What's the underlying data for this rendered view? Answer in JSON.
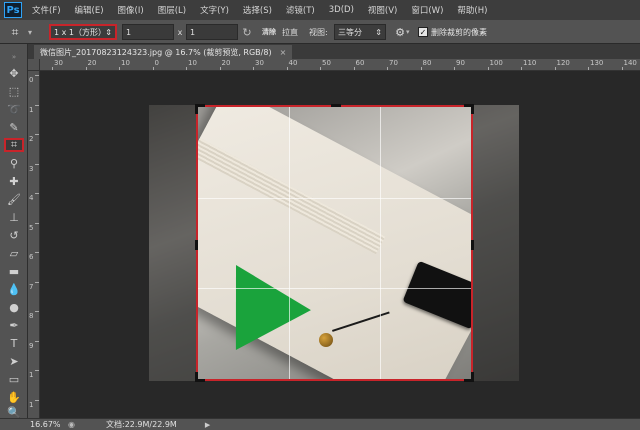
{
  "app": {
    "logo": "Ps"
  },
  "menu": [
    "文件(F)",
    "编辑(E)",
    "图像(I)",
    "图层(L)",
    "文字(Y)",
    "选择(S)",
    "滤镜(T)",
    "3D(D)",
    "视图(V)",
    "窗口(W)",
    "帮助(H)"
  ],
  "options": {
    "ratio_preset": "1 x 1（方形）",
    "width_value": "1",
    "x_separator": "x",
    "height_value": "1",
    "clear_label": "清除",
    "straighten_label": "拉直",
    "view_label": "视图:",
    "view_value": "三等分",
    "delete_pixels_label": "删除裁剪的像素",
    "delete_pixels_checked": true
  },
  "tab": {
    "title": "微信图片_20170823124323.jpg @ 16.7% (裁剪预览, RGB/8)",
    "close": "×"
  },
  "ruler_h": [
    "30",
    "20",
    "10",
    "0",
    "10",
    "20",
    "30",
    "40",
    "50",
    "60",
    "70",
    "80",
    "90",
    "100",
    "110",
    "120",
    "130",
    "140"
  ],
  "ruler_v": [
    "0",
    "1",
    "2",
    "3",
    "4",
    "5",
    "6",
    "7",
    "8",
    "9",
    "1",
    "1"
  ],
  "tools": [
    "move-icon",
    "marquee-icon",
    "lasso-icon",
    "quick-select-icon",
    "crop-icon",
    "eyedropper-icon",
    "healing-brush-icon",
    "brush-icon",
    "clone-stamp-icon",
    "history-brush-icon",
    "eraser-icon",
    "gradient-icon",
    "blur-icon",
    "dodge-icon",
    "pen-icon",
    "type-icon",
    "path-select-icon",
    "shape-icon",
    "hand-icon",
    "zoom-icon"
  ],
  "status": {
    "zoom": "16.67%",
    "doc_size": "文档:22.9M/22.9M"
  },
  "colors": {
    "highlight": "#c8242a",
    "panel": "#535353",
    "canvas": "#282828"
  }
}
